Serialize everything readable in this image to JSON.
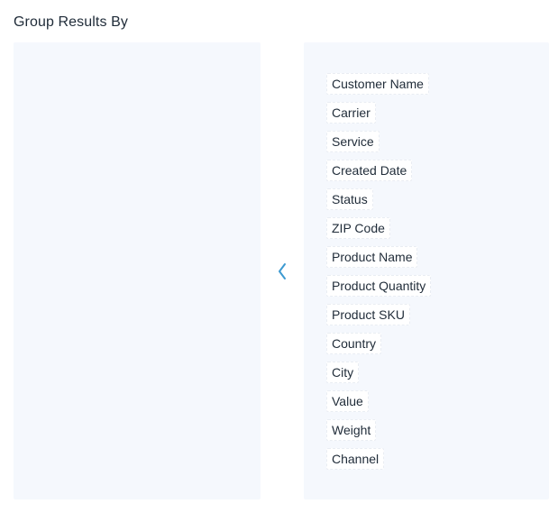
{
  "section": {
    "title": "Group Results By"
  },
  "transfer_button": {
    "icon": "chevron-left-icon",
    "color": "#3d9ad1"
  },
  "available_fields": [
    {
      "label": "Customer Name"
    },
    {
      "label": "Carrier"
    },
    {
      "label": "Service"
    },
    {
      "label": "Created Date"
    },
    {
      "label": "Status"
    },
    {
      "label": "ZIP Code"
    },
    {
      "label": "Product Name"
    },
    {
      "label": "Product Quantity"
    },
    {
      "label": "Product SKU"
    },
    {
      "label": "Country"
    },
    {
      "label": "City"
    },
    {
      "label": "Value"
    },
    {
      "label": "Weight"
    },
    {
      "label": "Channel"
    }
  ],
  "selected_fields": []
}
